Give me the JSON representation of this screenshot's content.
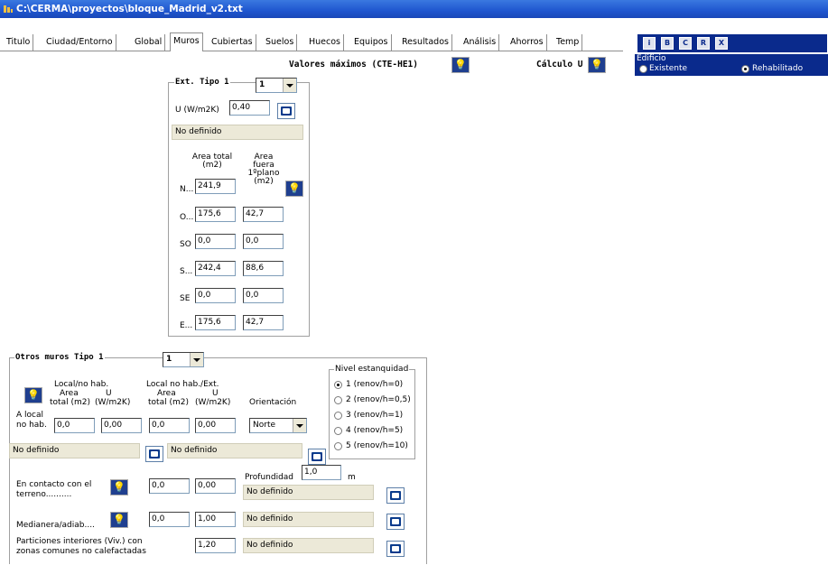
{
  "window": {
    "title": "C:\\CERMA\\proyectos\\bloque_Madrid_v2.txt"
  },
  "tabs": [
    "Titulo",
    "Ciudad/Entorno",
    "Global",
    "Muros",
    "Cubiertas",
    "Suelos",
    "Huecos",
    "Equipos",
    "Resultados",
    "Análisis",
    "Ahorros",
    "Temp"
  ],
  "toolbar": {
    "buttons": [
      "i",
      "B",
      "C",
      "R",
      "X"
    ]
  },
  "edificio": {
    "legend": "Edificio",
    "existente": "Existente",
    "rehabilitado": "Rehabilitado"
  },
  "header": {
    "valores_max": "Valores máximos (CTE-HE1)",
    "calculo_u": "Cálculo U"
  },
  "ext": {
    "title": "Ext. Tipo 1",
    "tipo_value": "1",
    "u_label": "U (W/m2K)",
    "u_value": "0,40",
    "status": "No definido",
    "col1_line1": "Area total",
    "col1_line2": "(m2)",
    "col2_line1": "Area",
    "col2_line2": "fuera",
    "col2_line3": "1ºplano",
    "col2_line4": "(m2)",
    "rows": [
      {
        "label": "N...",
        "total": "241,9",
        "fuera": null
      },
      {
        "label": "O...",
        "total": "175,6",
        "fuera": "42,7"
      },
      {
        "label": "SO",
        "total": "0,0",
        "fuera": "0,0"
      },
      {
        "label": "S...",
        "total": "242,4",
        "fuera": "88,6"
      },
      {
        "label": "SE",
        "total": "0,0",
        "fuera": "0,0"
      },
      {
        "label": "E...",
        "total": "175,6",
        "fuera": "42,7"
      }
    ]
  },
  "otros": {
    "title": "Otros muros Tipo 1",
    "tipo_value": "1",
    "local_no_hab": "Local/no hab.",
    "local_ext": "Local no hab./Ext.",
    "area": "Area",
    "total_m2": "total (m2)",
    "u": "U",
    "wm2k": "(W/m2K)",
    "orientacion": "Orientación",
    "a_local": "A local",
    "no_hab": "no hab.",
    "v1": "0,0",
    "v2": "0,00",
    "v3": "0,0",
    "v4": "0,00",
    "orient_value": "Norte",
    "status1": "No definido",
    "status2": "No definido",
    "contacto_1": "En contacto con el",
    "contacto_2": "terreno..........",
    "c_area": "0,0",
    "c_u": "0,00",
    "profundidad": "Profundidad",
    "prof_value": "1,0",
    "prof_unit": "m",
    "c_status": "No definido",
    "medianera": "Medianera/adiab....",
    "m_area": "0,0",
    "m_u": "1,00",
    "m_status": "No definido",
    "part_1": "Particiones interiores (Viv.) con",
    "part_2": "zonas comunes no calefactadas",
    "p_u": "1,20",
    "p_status": "No definido"
  },
  "estanq": {
    "legend": "Nivel estanquidad",
    "options": [
      "1 (renov/h=0)",
      "2 (renov/h=0,5)",
      "3 (renov/h=1)",
      "4 (renov/h=5)",
      "5 (renov/h=10)"
    ],
    "selected": 0
  },
  "colors": {
    "title_bar": "#1f56cf",
    "panel_blue": "#0a2a8c",
    "gray_field": "#ece9d8"
  }
}
